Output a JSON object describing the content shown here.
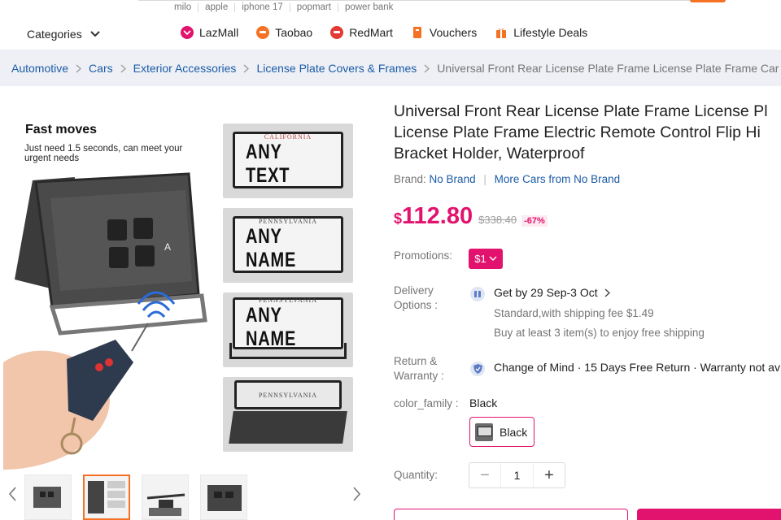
{
  "header": {
    "hot_words": [
      "milo",
      "apple",
      "iphone 17",
      "popmart",
      "power bank"
    ],
    "categories_label": "Categories",
    "channels": [
      {
        "label": "LazMall",
        "icon": "lazmall-icon",
        "color": "#e2136e"
      },
      {
        "label": "Taobao",
        "icon": "taobao-icon",
        "color": "#f57224"
      },
      {
        "label": "RedMart",
        "icon": "redmart-icon",
        "color": "#e53935"
      },
      {
        "label": "Vouchers",
        "icon": "voucher-icon",
        "color": "#f57224"
      },
      {
        "label": "Lifestyle Deals",
        "icon": "gift-icon",
        "color": "#f57224"
      }
    ]
  },
  "breadcrumb": [
    "Automotive",
    "Cars",
    "Exterior Accessories",
    "License Plate Covers & Frames",
    "Universal Front Rear License Plate Frame License Plate Frame Car Licen"
  ],
  "gallery": {
    "main_heading": "Fast moves",
    "main_sub": "Just need 1.5 seconds, can meet your urgent needs",
    "panels": [
      {
        "state": "CALIFORNIA",
        "text": "ANY TEXT"
      },
      {
        "state": "PENNSYLVANIA",
        "text": "ANY NAME"
      },
      {
        "state": "PENNSYLVANIA",
        "text": "ANY NAME"
      },
      {
        "state": "PENNSYLVANIA",
        "text": ""
      }
    ]
  },
  "product": {
    "title_lines": [
      "Universal Front Rear License Plate Frame License Pl",
      "License Plate Frame Electric Remote Control Flip Hi",
      "Bracket Holder, Waterproof"
    ],
    "brand_label": "Brand:",
    "brand_value": "No Brand",
    "more_from": "More Cars from No Brand",
    "currency": "$",
    "price": "112.80",
    "original_price": "$338.40",
    "discount": "-67%",
    "promotions_label": "Promotions:",
    "promotion_tag": "$1",
    "delivery_label": "Delivery Options :",
    "delivery_date": "Get by 29 Sep-3 Oct",
    "delivery_fee": "Standard,with shipping fee $1.49",
    "delivery_free": "Buy at least 3 item(s) to enjoy free shipping",
    "return_label": "Return & Warranty :",
    "return_text": "Change of Mind · 15 Days Free Return · Warranty not av",
    "color_label": "color_family :",
    "color_value": "Black",
    "color_option": "Black",
    "quantity_label": "Quantity:",
    "quantity_value": "1",
    "minus_symbol": "−",
    "plus_symbol": "+"
  },
  "colors": {
    "brand_pink": "#e2136e",
    "link_blue": "#1a5ba6",
    "breadcrumb_bg": "#eff0f5"
  }
}
